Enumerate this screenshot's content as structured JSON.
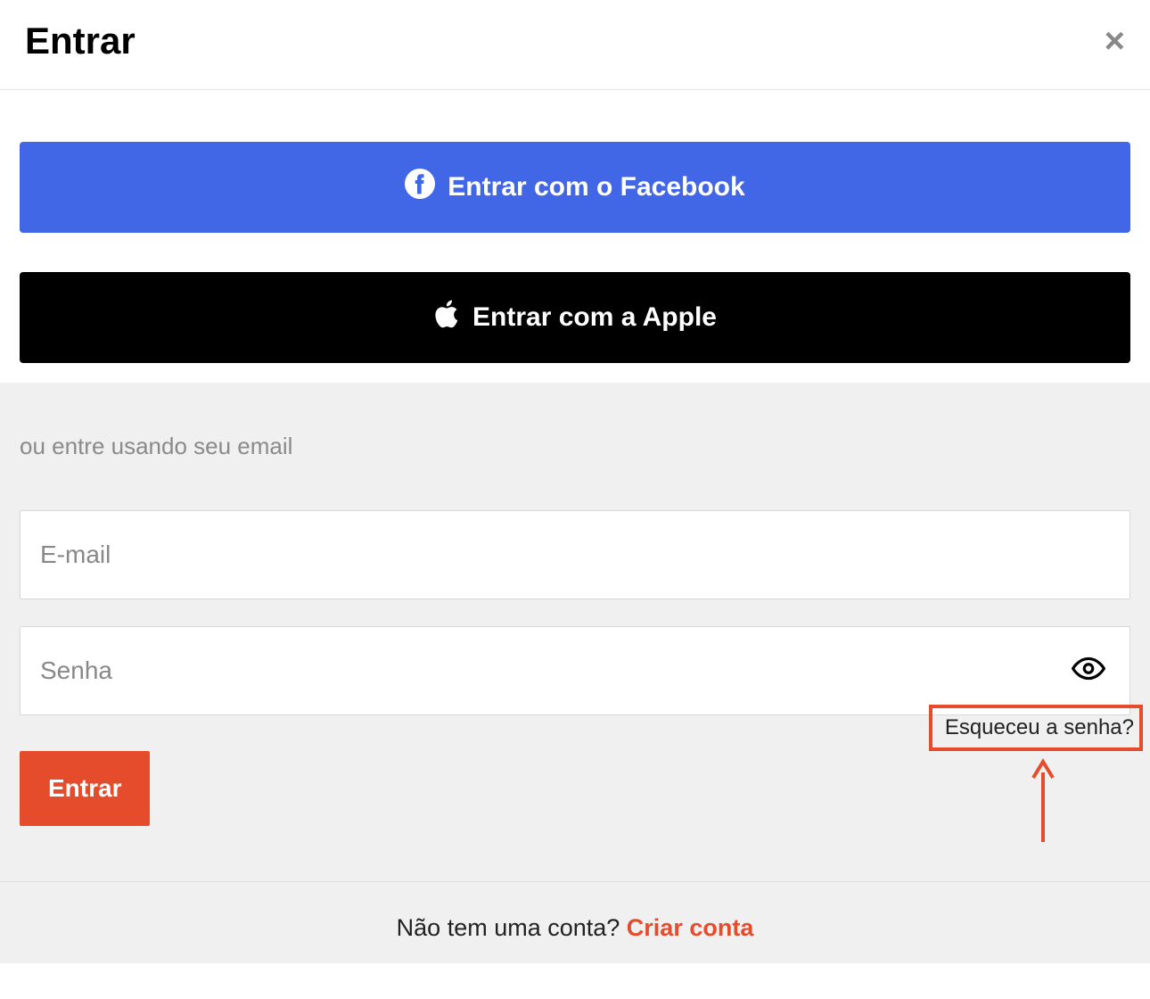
{
  "header": {
    "title": "Entrar"
  },
  "social": {
    "facebook_label": "Entrar com o Facebook",
    "apple_label": "Entrar com a Apple"
  },
  "email_section": {
    "prompt": "ou entre usando seu email",
    "email_placeholder": "E-mail",
    "password_placeholder": "Senha",
    "forgot_label": "Esqueceu a senha?",
    "submit_label": "Entrar"
  },
  "footer": {
    "prompt": "Não tem uma conta? ",
    "create_label": "Criar conta"
  }
}
